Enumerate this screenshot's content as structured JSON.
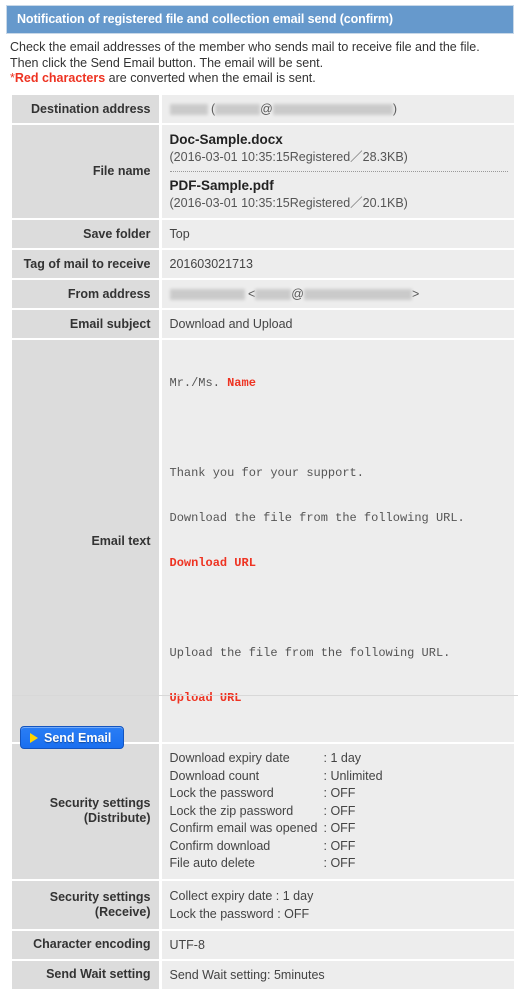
{
  "header": {
    "title": "Notification of registered file and collection email send (confirm)",
    "accent_color": "#6699cc"
  },
  "intro": {
    "line1": "Check the email addresses of the member who sends mail to receive file and the file.",
    "line2": "Then click the Send Email button. The email will be sent.",
    "star": "*",
    "red_note": "Red characters",
    "line3_tail": " are converted when the email is sent.",
    "red_color": "#ee3322"
  },
  "fields": {
    "destination_address": {
      "label": "Destination address",
      "redacted": true,
      "open_paren": "(",
      "at": "@",
      "close_paren": ")"
    },
    "file_name": {
      "label": "File name",
      "files": [
        {
          "name": "Doc-Sample.docx",
          "meta": "(2016-03-01 10:35:15Registered／28.3KB)"
        },
        {
          "name": "PDF-Sample.pdf",
          "meta": "(2016-03-01 10:35:15Registered／20.1KB)"
        }
      ]
    },
    "save_folder": {
      "label": "Save folder",
      "value": "Top"
    },
    "tag_of_mail": {
      "label": "Tag of mail to receive",
      "value": "201603021713"
    },
    "from_address": {
      "label": "From address",
      "redacted": true,
      "open_angle": "<",
      "at": "@",
      "close_angle": ">"
    },
    "email_subject": {
      "label": "Email subject",
      "value": "Download and Upload"
    },
    "email_text": {
      "label": "Email text",
      "salutation_prefix": "Mr./Ms. ",
      "salutation_placeholder": "Name",
      "paragraph1_line1": "Thank you for your support.",
      "paragraph1_line2": "Download the file from the following URL.",
      "download_placeholder": "Download URL",
      "paragraph2_line1": "Upload the file from the following URL.",
      "upload_placeholder": "Upload URL"
    },
    "security_distribute": {
      "label_line1": "Security settings",
      "label_line2": "(Distribute)",
      "items": [
        {
          "key": "Download expiry date",
          "value": ": 1 day"
        },
        {
          "key": "Download count",
          "value": ": Unlimited"
        },
        {
          "key": "Lock the password",
          "value": ": OFF"
        },
        {
          "key": "Lock the zip password",
          "value": ": OFF"
        },
        {
          "key": "Confirm email was opened",
          "value": ": OFF"
        },
        {
          "key": "Confirm download",
          "value": ": OFF"
        },
        {
          "key": "File auto delete",
          "value": ": OFF"
        }
      ]
    },
    "security_receive": {
      "label_line1": "Security settings",
      "label_line2": "(Receive)",
      "items": [
        "Collect expiry date : 1 day",
        "Lock the password : OFF"
      ]
    },
    "character_encoding": {
      "label": "Character encoding",
      "value": "UTF-8"
    },
    "send_wait_setting": {
      "label": "Send Wait setting",
      "value": "Send Wait setting: 5minutes"
    }
  },
  "actions": {
    "send_email_label": "Send Email",
    "send_email_icon": "play-triangle-icon",
    "button_color": "#1a6ff0"
  }
}
